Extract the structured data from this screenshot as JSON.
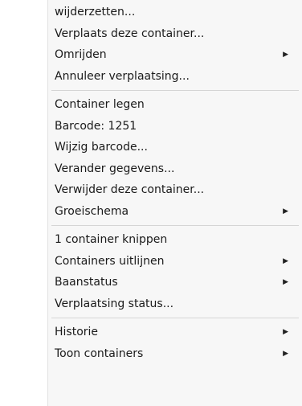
{
  "menu": {
    "items": [
      {
        "label": "wijderzetten...",
        "submenu": false
      },
      {
        "label": "Verplaats deze container...",
        "submenu": false
      },
      {
        "label": "Omrijden",
        "submenu": true
      },
      {
        "label": "Annuleer verplaatsing...",
        "submenu": false
      },
      {
        "label": "Container legen",
        "submenu": false
      },
      {
        "label": "Barcode: 1251",
        "submenu": false
      },
      {
        "label": "Wijzig barcode...",
        "submenu": false
      },
      {
        "label": "Verander gegevens...",
        "submenu": false
      },
      {
        "label": "Verwijder deze container...",
        "submenu": false
      },
      {
        "label": "Groeischema",
        "submenu": true
      },
      {
        "label": "1 container knippen",
        "submenu": false
      },
      {
        "label": "Containers uitlijnen",
        "submenu": true
      },
      {
        "label": "Baanstatus",
        "submenu": true
      },
      {
        "label": "Verplaatsing status...",
        "submenu": false
      },
      {
        "label": "Historie",
        "submenu": true
      },
      {
        "label": "Toon containers",
        "submenu": true
      }
    ],
    "submenu_arrow": "▶"
  }
}
